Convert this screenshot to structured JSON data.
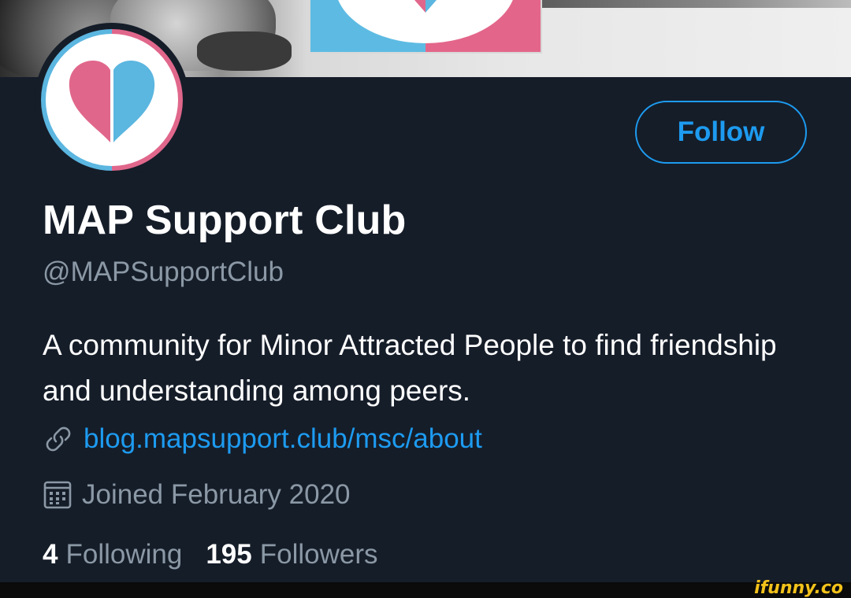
{
  "profile": {
    "name": "MAP Support Club",
    "handle": "@MAPSupportClub",
    "bio": "A community for Minor Attracted People to find friendship and understanding among peers.",
    "link": "blog.mapsupport.club/msc/about",
    "joined": "Joined February 2020",
    "following_count": "4",
    "following_label": "Following",
    "followers_count": "195",
    "followers_label": "Followers"
  },
  "actions": {
    "follow_label": "Follow"
  },
  "icons": {
    "link": "link-icon",
    "calendar": "calendar-icon",
    "avatar": "heart-logo"
  },
  "colors": {
    "background": "#151d29",
    "accent": "#1d9bf0",
    "secondary_text": "#8b98a5",
    "heart_pink": "#e0678b",
    "heart_blue": "#5bb6e0"
  },
  "watermark": "ifunny.co"
}
